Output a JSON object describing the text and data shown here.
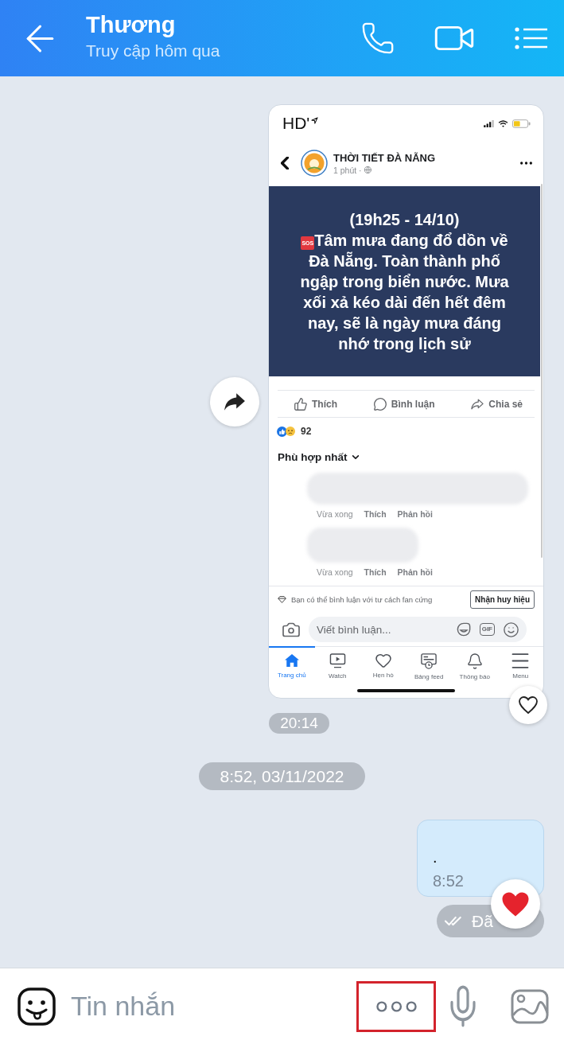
{
  "header": {
    "title": "Thương",
    "subtitle": "Truy cập hôm qua"
  },
  "shared_post_message": {
    "reacted": false,
    "screenshot": {
      "status_bar": {
        "carrier": "HD'"
      },
      "post": {
        "page_name": "THỜI TIẾT ĐÀ NẴNG",
        "posted": "1 phút ·",
        "heading": "(19h25 - 14/10)",
        "sos_badge": "SOS",
        "body_lines": [
          "Tâm mưa đang đổ dồn về",
          "Đà Nẵng. Toàn thành phố",
          "ngập trong biển nước. Mưa",
          "xối xả kéo dài đến hết đêm",
          "nay, sẽ là ngày mưa đáng",
          "nhớ trong lịch sử"
        ],
        "actions": [
          {
            "kind": "like",
            "label": "Thích"
          },
          {
            "kind": "comment",
            "label": "Bình luận"
          },
          {
            "kind": "share",
            "label": "Chia sẻ"
          }
        ],
        "reaction_count": "92",
        "sort_label": "Phù hợp nhất",
        "comments": [
          {
            "time": "Vừa xong",
            "like": "Thích",
            "reply": "Phản hồi"
          },
          {
            "time": "Vừa xong",
            "like": "Thích",
            "reply": "Phản hồi"
          }
        ],
        "fan_note": "Bạn có thể bình luận với tư cách fan cứng",
        "badge_button": "Nhận huy hiệu",
        "comment_placeholder": "Viết bình luận...",
        "gif_label": "GIF"
      },
      "tabs": [
        {
          "kind": "home",
          "label": "Trang chủ",
          "selected": true
        },
        {
          "kind": "watch",
          "label": "Watch",
          "selected": false
        },
        {
          "kind": "dating",
          "label": "Hẹn hò",
          "selected": false
        },
        {
          "kind": "feed",
          "label": "Bảng feed",
          "selected": false
        },
        {
          "kind": "bell",
          "label": "Thông báo",
          "selected": false
        },
        {
          "kind": "menu",
          "label": "Menu",
          "selected": false
        }
      ]
    }
  },
  "time_label": "20:14",
  "date_label": "8:52, 03/11/2022",
  "message": {
    "text": ".",
    "time": "8:52",
    "status": "Đã",
    "reacted": true
  },
  "composer": {
    "placeholder": "Tin nhắn",
    "more_highlighted": true
  }
}
